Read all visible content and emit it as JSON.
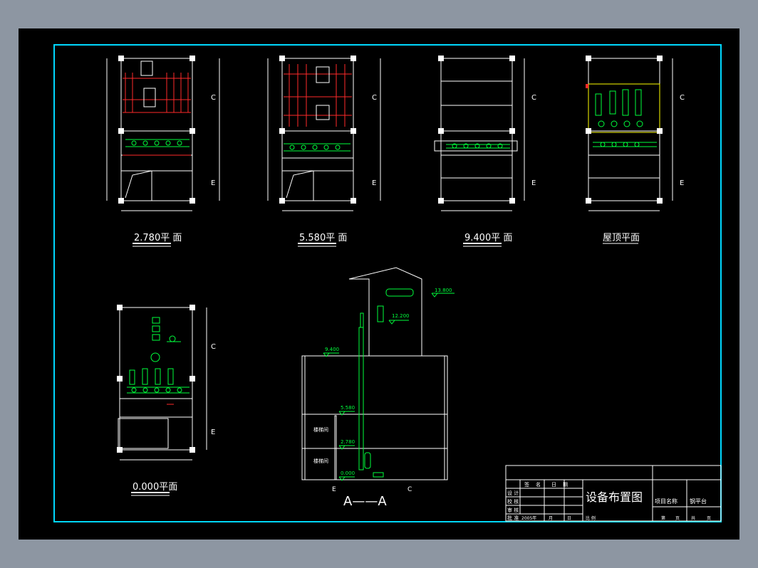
{
  "plans": [
    {
      "caption": "2.780平 面",
      "axis_top": "C",
      "axis_bottom": "E"
    },
    {
      "caption": "5.580平 面",
      "axis_top": "C",
      "axis_bottom": "E"
    },
    {
      "caption": "9.400平 面",
      "axis_top": "C",
      "axis_bottom": "E"
    },
    {
      "caption": "屋顶平面",
      "axis_top": "C",
      "axis_bottom": "E"
    },
    {
      "caption": "0.000平面",
      "axis_top": "C",
      "axis_bottom": "E"
    }
  ],
  "section": {
    "title": "A——A",
    "axis_left": "E",
    "axis_right": "C",
    "elevations": [
      "13.800",
      "12.200",
      "9.400",
      "5.580",
      "2.780",
      "0.000"
    ],
    "room_labels": [
      "楼梯间",
      "楼梯间"
    ]
  },
  "title_block": {
    "drawing_title": "设备布置图",
    "project_label": "项目名称",
    "project_value": "钢平台",
    "sign_header": [
      "签",
      "名",
      "日",
      "期"
    ],
    "roles": [
      "设 计",
      "校 核",
      "审 核",
      "批 准"
    ],
    "date_row": [
      "2005年",
      "月",
      "日"
    ],
    "scale_label": "比 例",
    "sheet_labels": [
      "第",
      "页",
      "共",
      "页"
    ]
  }
}
